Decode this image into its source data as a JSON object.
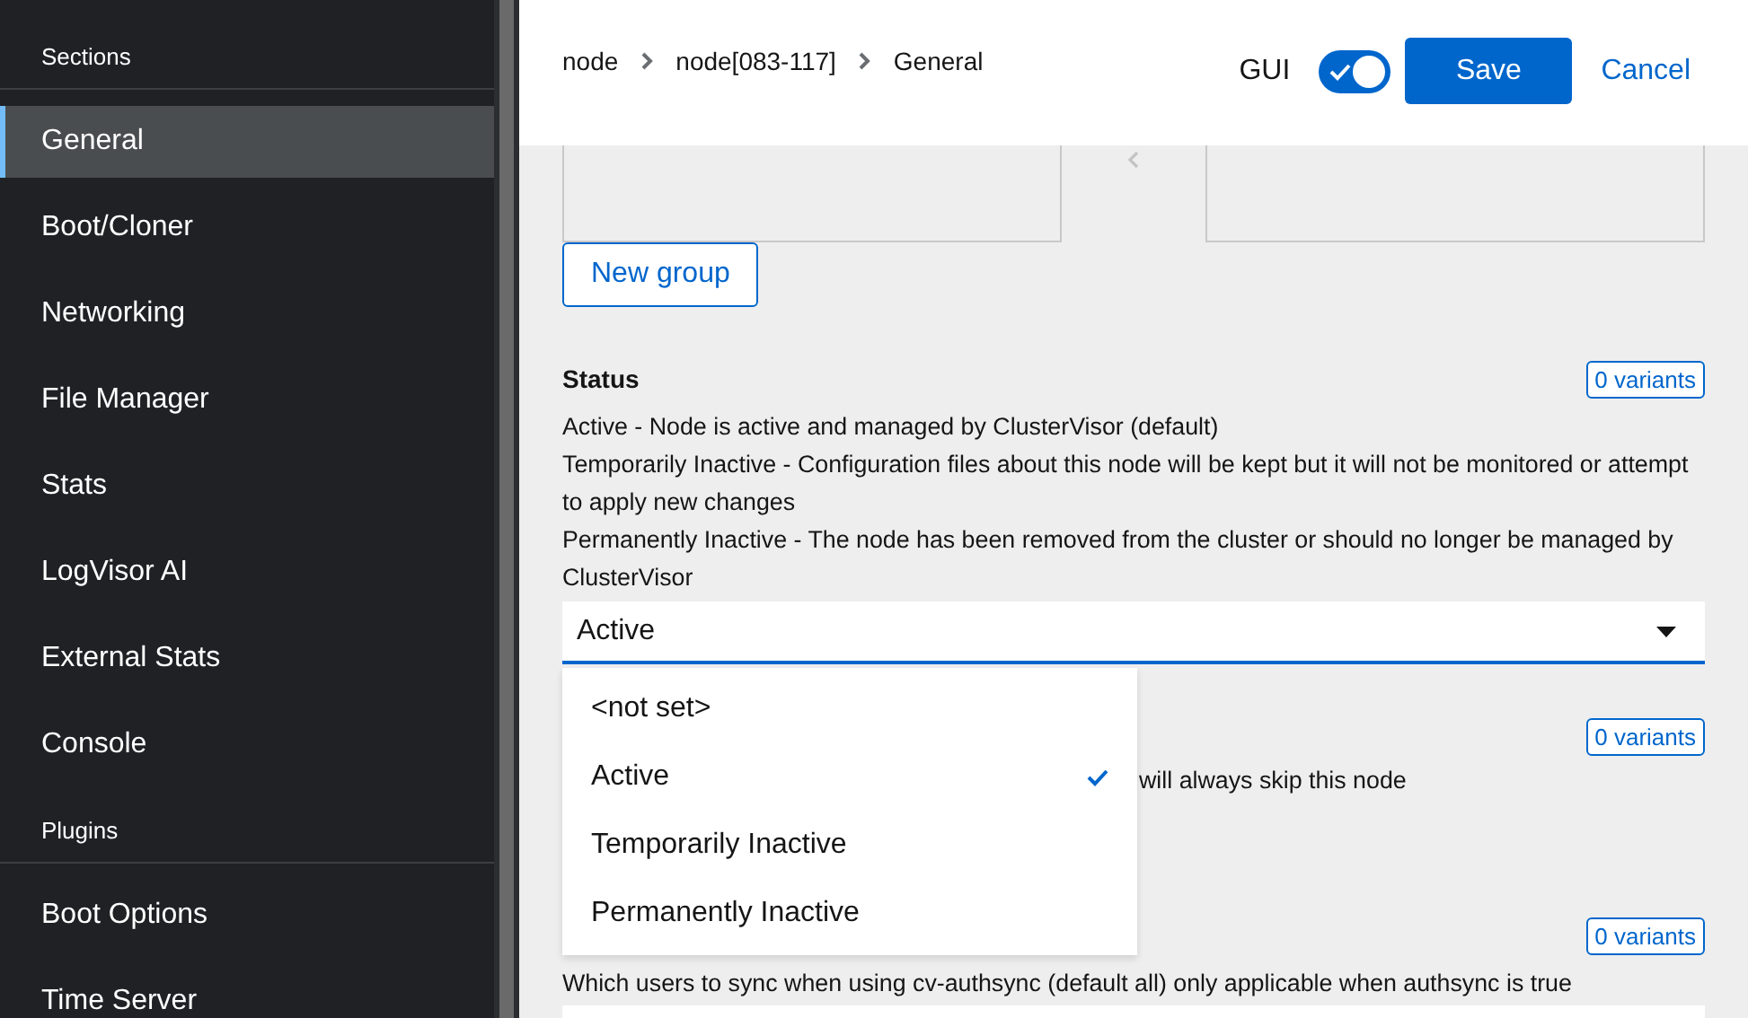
{
  "sidebar": {
    "groups": [
      {
        "heading": "Sections",
        "items": [
          {
            "label": "General",
            "selected": true
          },
          {
            "label": "Boot/Cloner",
            "selected": false
          },
          {
            "label": "Networking",
            "selected": false
          },
          {
            "label": "File Manager",
            "selected": false
          },
          {
            "label": "Stats",
            "selected": false
          },
          {
            "label": "LogVisor AI",
            "selected": false
          },
          {
            "label": "External Stats",
            "selected": false
          },
          {
            "label": "Console",
            "selected": false
          }
        ]
      },
      {
        "heading": "Plugins",
        "items": [
          {
            "label": "Boot Options",
            "selected": false
          },
          {
            "label": "Time Server",
            "selected": false
          }
        ]
      }
    ]
  },
  "header": {
    "breadcrumb": [
      "node",
      "node[083-117]",
      "General"
    ],
    "gui_toggle": {
      "label": "GUI",
      "on": true
    },
    "save_button": "Save",
    "cancel_button": "Cancel"
  },
  "groups": {
    "new_group_button": "New group"
  },
  "status": {
    "title": "Status",
    "variants": "0 variants",
    "description": [
      "Active - Node is active and managed by ClusterVisor (default)",
      "Temporarily Inactive - Configuration files about this node will be kept but it will not be monitored or attempt to apply new changes",
      "Permanently Inactive - The node has been removed from the cluster or should no longer be managed by ClusterVisor"
    ],
    "select": {
      "value": "Active",
      "expanded": true,
      "options": [
        {
          "label": "<not set>",
          "selected": false
        },
        {
          "label": "Active",
          "selected": true
        },
        {
          "label": "Temporarily Inactive",
          "selected": false
        },
        {
          "label": "Permanently Inactive",
          "selected": false
        }
      ]
    }
  },
  "sections": [
    {
      "variants": "0 variants",
      "description": "will always skip this node"
    },
    {
      "variants": "0 variants",
      "description": "Which users to sync when using cv-authsync (default all) only applicable when authsync is true"
    }
  ]
}
